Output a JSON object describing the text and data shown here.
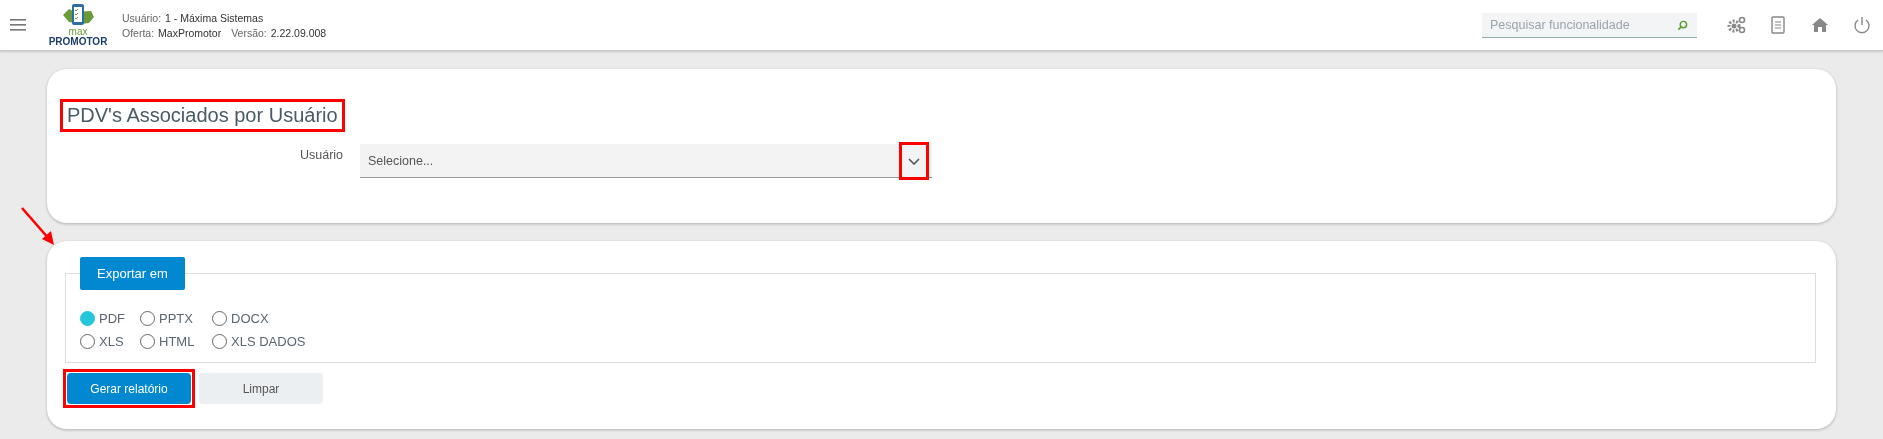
{
  "header": {
    "logo": {
      "line_1": "max",
      "line_2": "PROMOTOR"
    },
    "info": [
      {
        "label": "Usuário:",
        "value": "1 - Máxima Sistemas"
      },
      {
        "label": "Oferta:",
        "value": "MaxPromotor"
      },
      {
        "label": "Versão:",
        "value": "2.22.09.008"
      }
    ],
    "search": {
      "placeholder": "Pesquisar funcionalidade"
    }
  },
  "filter_card": {
    "title": "PDV's Associados por Usuário",
    "title_highlighted": true,
    "field": {
      "label": "Usuário",
      "placeholder": "Selecione...",
      "toggle_highlighted": true
    }
  },
  "export_card": {
    "arrow_marker": true,
    "legend": "Exportar em",
    "options": [
      {
        "label": "PDF",
        "selected": true
      },
      {
        "label": "PPTX",
        "selected": false
      },
      {
        "label": "DOCX",
        "selected": false
      },
      {
        "label": "XLS",
        "selected": false
      },
      {
        "label": "HTML",
        "selected": false
      },
      {
        "label": "XLS DADOS",
        "selected": false
      }
    ],
    "buttons": [
      {
        "label": "Gerar relatório",
        "kind": "primary",
        "highlighted": true
      },
      {
        "label": "Limpar",
        "kind": "secondary",
        "highlighted": false
      }
    ]
  }
}
